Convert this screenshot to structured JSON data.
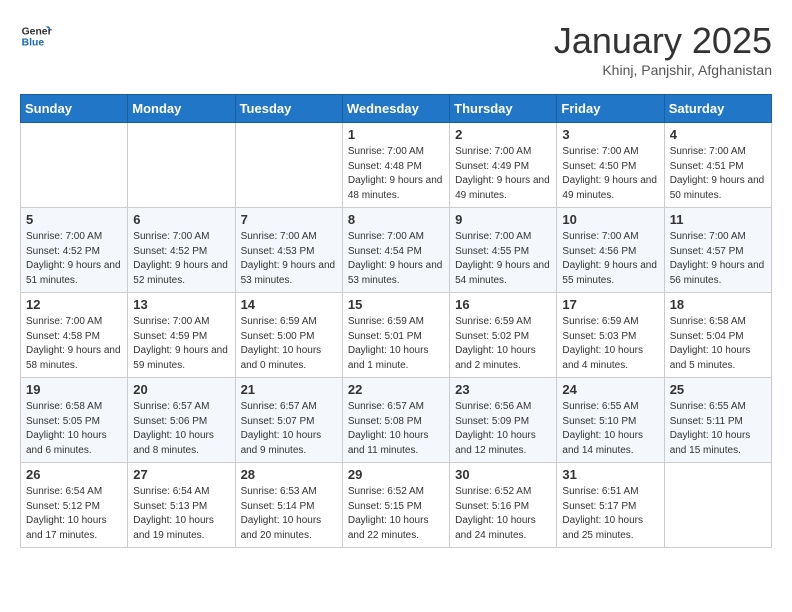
{
  "header": {
    "logo_line1": "General",
    "logo_line2": "Blue",
    "month": "January 2025",
    "location": "Khinj, Panjshir, Afghanistan"
  },
  "weekdays": [
    "Sunday",
    "Monday",
    "Tuesday",
    "Wednesday",
    "Thursday",
    "Friday",
    "Saturday"
  ],
  "weeks": [
    [
      {
        "day": "",
        "info": ""
      },
      {
        "day": "",
        "info": ""
      },
      {
        "day": "",
        "info": ""
      },
      {
        "day": "1",
        "info": "Sunrise: 7:00 AM\nSunset: 4:48 PM\nDaylight: 9 hours and 48 minutes."
      },
      {
        "day": "2",
        "info": "Sunrise: 7:00 AM\nSunset: 4:49 PM\nDaylight: 9 hours and 49 minutes."
      },
      {
        "day": "3",
        "info": "Sunrise: 7:00 AM\nSunset: 4:50 PM\nDaylight: 9 hours and 49 minutes."
      },
      {
        "day": "4",
        "info": "Sunrise: 7:00 AM\nSunset: 4:51 PM\nDaylight: 9 hours and 50 minutes."
      }
    ],
    [
      {
        "day": "5",
        "info": "Sunrise: 7:00 AM\nSunset: 4:52 PM\nDaylight: 9 hours and 51 minutes."
      },
      {
        "day": "6",
        "info": "Sunrise: 7:00 AM\nSunset: 4:52 PM\nDaylight: 9 hours and 52 minutes."
      },
      {
        "day": "7",
        "info": "Sunrise: 7:00 AM\nSunset: 4:53 PM\nDaylight: 9 hours and 53 minutes."
      },
      {
        "day": "8",
        "info": "Sunrise: 7:00 AM\nSunset: 4:54 PM\nDaylight: 9 hours and 53 minutes."
      },
      {
        "day": "9",
        "info": "Sunrise: 7:00 AM\nSunset: 4:55 PM\nDaylight: 9 hours and 54 minutes."
      },
      {
        "day": "10",
        "info": "Sunrise: 7:00 AM\nSunset: 4:56 PM\nDaylight: 9 hours and 55 minutes."
      },
      {
        "day": "11",
        "info": "Sunrise: 7:00 AM\nSunset: 4:57 PM\nDaylight: 9 hours and 56 minutes."
      }
    ],
    [
      {
        "day": "12",
        "info": "Sunrise: 7:00 AM\nSunset: 4:58 PM\nDaylight: 9 hours and 58 minutes."
      },
      {
        "day": "13",
        "info": "Sunrise: 7:00 AM\nSunset: 4:59 PM\nDaylight: 9 hours and 59 minutes."
      },
      {
        "day": "14",
        "info": "Sunrise: 6:59 AM\nSunset: 5:00 PM\nDaylight: 10 hours and 0 minutes."
      },
      {
        "day": "15",
        "info": "Sunrise: 6:59 AM\nSunset: 5:01 PM\nDaylight: 10 hours and 1 minute."
      },
      {
        "day": "16",
        "info": "Sunrise: 6:59 AM\nSunset: 5:02 PM\nDaylight: 10 hours and 2 minutes."
      },
      {
        "day": "17",
        "info": "Sunrise: 6:59 AM\nSunset: 5:03 PM\nDaylight: 10 hours and 4 minutes."
      },
      {
        "day": "18",
        "info": "Sunrise: 6:58 AM\nSunset: 5:04 PM\nDaylight: 10 hours and 5 minutes."
      }
    ],
    [
      {
        "day": "19",
        "info": "Sunrise: 6:58 AM\nSunset: 5:05 PM\nDaylight: 10 hours and 6 minutes."
      },
      {
        "day": "20",
        "info": "Sunrise: 6:57 AM\nSunset: 5:06 PM\nDaylight: 10 hours and 8 minutes."
      },
      {
        "day": "21",
        "info": "Sunrise: 6:57 AM\nSunset: 5:07 PM\nDaylight: 10 hours and 9 minutes."
      },
      {
        "day": "22",
        "info": "Sunrise: 6:57 AM\nSunset: 5:08 PM\nDaylight: 10 hours and 11 minutes."
      },
      {
        "day": "23",
        "info": "Sunrise: 6:56 AM\nSunset: 5:09 PM\nDaylight: 10 hours and 12 minutes."
      },
      {
        "day": "24",
        "info": "Sunrise: 6:55 AM\nSunset: 5:10 PM\nDaylight: 10 hours and 14 minutes."
      },
      {
        "day": "25",
        "info": "Sunrise: 6:55 AM\nSunset: 5:11 PM\nDaylight: 10 hours and 15 minutes."
      }
    ],
    [
      {
        "day": "26",
        "info": "Sunrise: 6:54 AM\nSunset: 5:12 PM\nDaylight: 10 hours and 17 minutes."
      },
      {
        "day": "27",
        "info": "Sunrise: 6:54 AM\nSunset: 5:13 PM\nDaylight: 10 hours and 19 minutes."
      },
      {
        "day": "28",
        "info": "Sunrise: 6:53 AM\nSunset: 5:14 PM\nDaylight: 10 hours and 20 minutes."
      },
      {
        "day": "29",
        "info": "Sunrise: 6:52 AM\nSunset: 5:15 PM\nDaylight: 10 hours and 22 minutes."
      },
      {
        "day": "30",
        "info": "Sunrise: 6:52 AM\nSunset: 5:16 PM\nDaylight: 10 hours and 24 minutes."
      },
      {
        "day": "31",
        "info": "Sunrise: 6:51 AM\nSunset: 5:17 PM\nDaylight: 10 hours and 25 minutes."
      },
      {
        "day": "",
        "info": ""
      }
    ]
  ]
}
